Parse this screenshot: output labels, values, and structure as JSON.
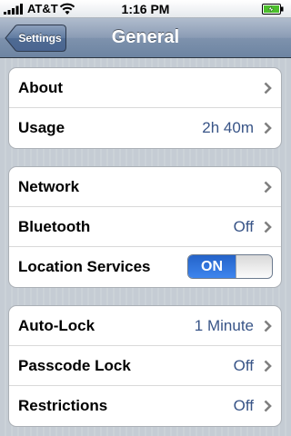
{
  "status_bar": {
    "carrier": "AT&T",
    "time": "1:16 PM",
    "icons": [
      "signal-bars-icon",
      "wifi-icon",
      "battery-charging-icon"
    ]
  },
  "nav_bar": {
    "back_label": "Settings",
    "title": "General"
  },
  "groups": [
    {
      "rows": [
        {
          "label": "About",
          "value": ""
        },
        {
          "label": "Usage",
          "value": "2h 40m"
        }
      ]
    },
    {
      "rows": [
        {
          "label": "Network",
          "value": ""
        },
        {
          "label": "Bluetooth",
          "value": "Off"
        },
        {
          "label": "Location Services",
          "toggle": "ON",
          "toggle_state": true
        }
      ]
    },
    {
      "rows": [
        {
          "label": "Auto-Lock",
          "value": "1 Minute"
        },
        {
          "label": "Passcode Lock",
          "value": "Off"
        },
        {
          "label": "Restrictions",
          "value": "Off"
        }
      ]
    }
  ],
  "colors": {
    "value_text": "#385487",
    "toggle_on": "#3175e0",
    "nav_bar": "#6d84a2"
  }
}
